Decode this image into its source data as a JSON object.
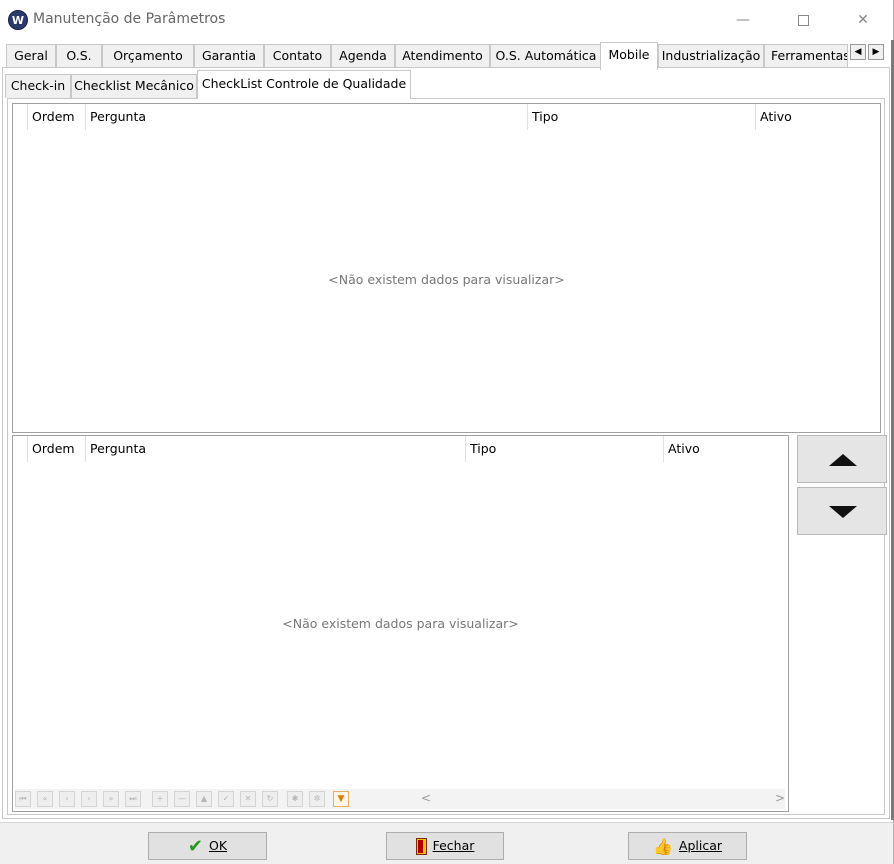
{
  "window": {
    "app_icon": "vw-logo-icon",
    "title": "Manutenção de Parâmetros",
    "minimize_glyph": "—",
    "close_glyph": "✕"
  },
  "main_tabs": [
    {
      "label": "Geral",
      "active": false
    },
    {
      "label": "O.S.",
      "active": false
    },
    {
      "label": "Orçamento",
      "active": false
    },
    {
      "label": "Garantia",
      "active": false
    },
    {
      "label": "Contato",
      "active": false
    },
    {
      "label": "Agenda",
      "active": false
    },
    {
      "label": "Atendimento",
      "active": false
    },
    {
      "label": "O.S. Automática",
      "active": false
    },
    {
      "label": "Mobile",
      "active": true
    },
    {
      "label": "Industrialização",
      "active": false
    },
    {
      "label": "Ferramentas",
      "active": false
    }
  ],
  "sub_tabs": [
    {
      "label": "Check-in",
      "active": false
    },
    {
      "label": "Checklist Mecânico",
      "active": false
    },
    {
      "label": "CheckList Controle de Qualidade",
      "active": true
    }
  ],
  "top_grid": {
    "columns": [
      "Ordem",
      "Pergunta",
      "Tipo",
      "Ativo"
    ],
    "empty_message": "<Não existem dados para visualizar>"
  },
  "bottom_grid": {
    "columns": [
      "Ordem",
      "Pergunta",
      "Tipo",
      "Ativo"
    ],
    "empty_message": "<Não existem dados para visualizar>"
  },
  "move_buttons": {
    "up_icon": "triangle-up-icon",
    "down_icon": "triangle-down-icon"
  },
  "navigator": {
    "icons": [
      "first-icon",
      "prev-page-icon",
      "prev-icon",
      "next-icon",
      "next-page-icon",
      "last-icon",
      "insert-icon",
      "delete-icon",
      "edit-icon",
      "post-icon",
      "cancel-icon",
      "refresh-icon",
      "bookmark-icon",
      "goto-bookmark-icon",
      "filter-icon"
    ],
    "glyphs": [
      "⏮",
      "«",
      "‹",
      "›",
      "»",
      "⏭",
      "+",
      "—",
      "▲",
      "✓",
      "✕",
      "↻",
      "✱",
      "✲",
      "▼"
    ],
    "scroll_left": "<",
    "scroll_right": ">"
  },
  "footer": {
    "ok_label": "OK",
    "close_label": "Fechar",
    "apply_label": "Aplicar",
    "ok_glyph": "✔",
    "apply_glyph": "👍"
  },
  "colors": {
    "window_bg": "#ffffff",
    "tab_bg": "#f0f0f0",
    "button_bg": "#e1e1e1",
    "empty_text": "#777777",
    "ok_check": "#1f9b1f",
    "filter_orange": "#e07a00"
  }
}
